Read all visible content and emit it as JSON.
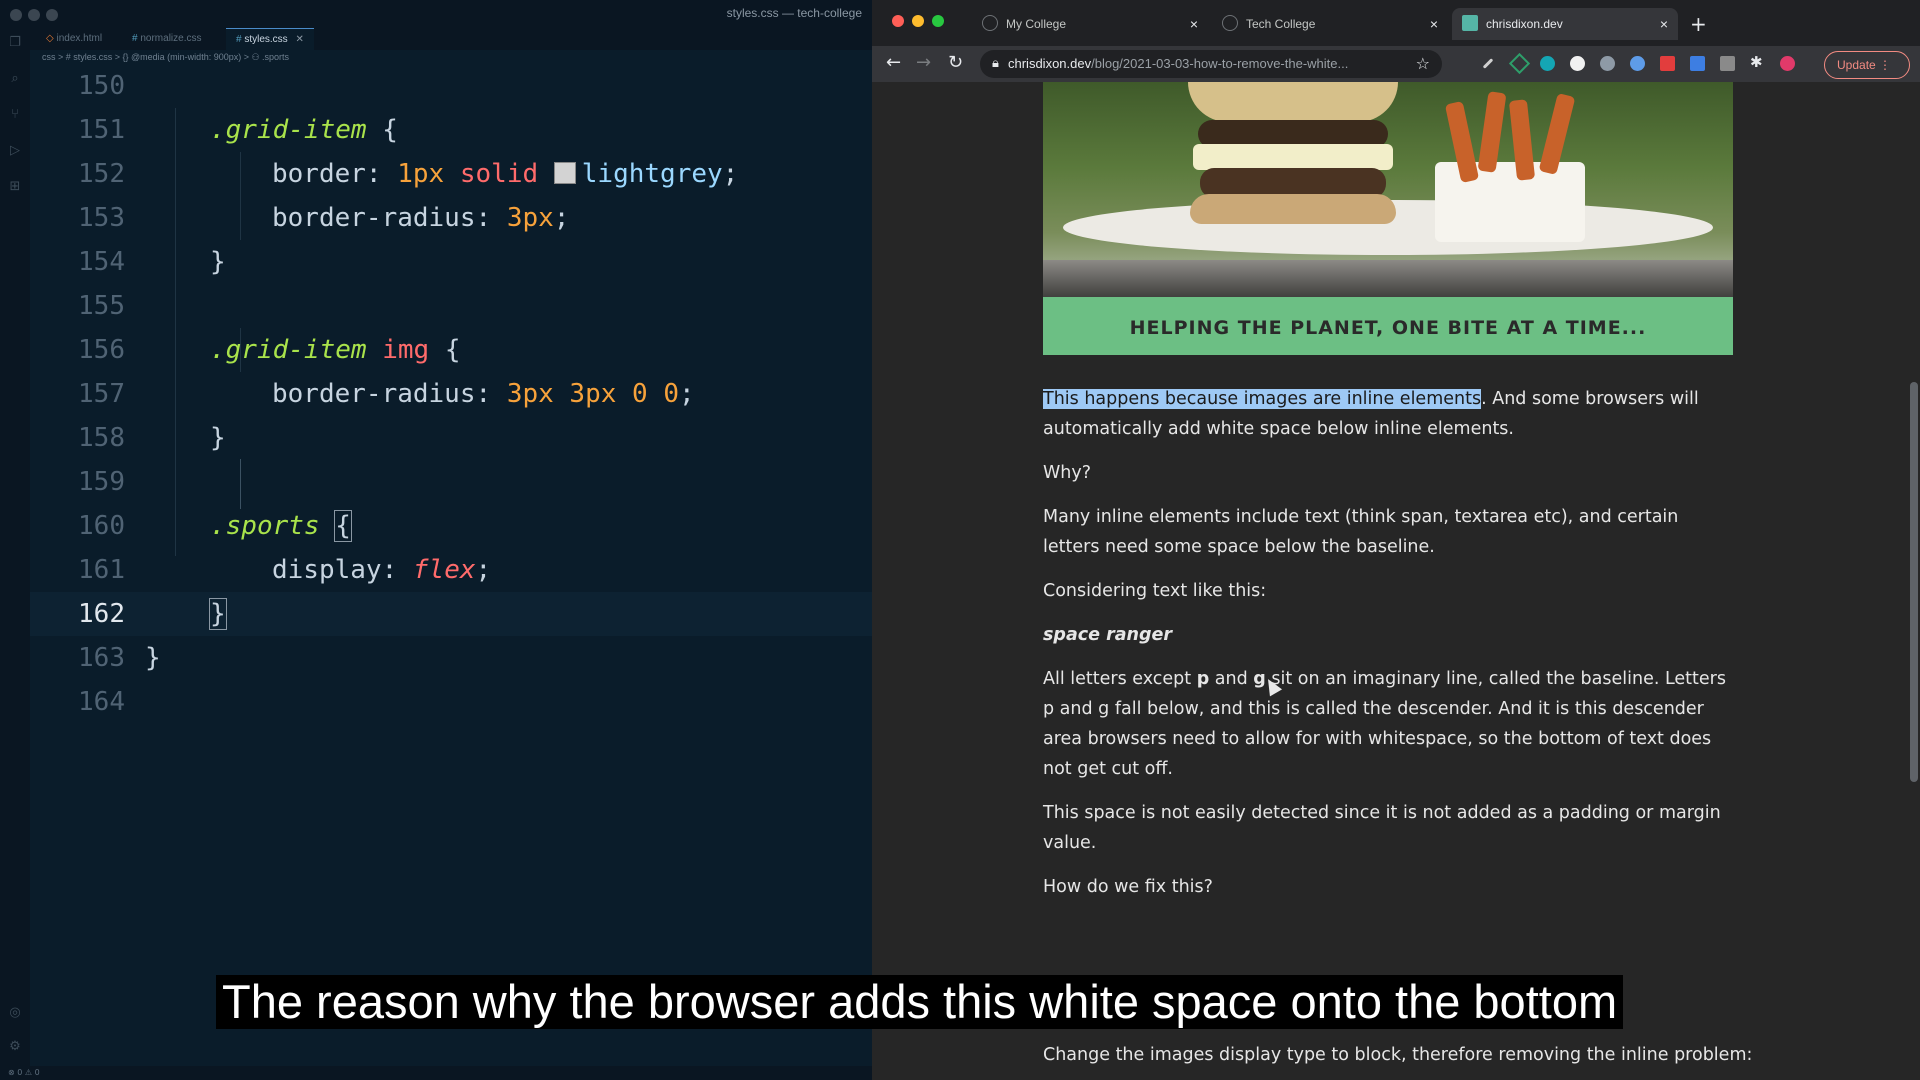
{
  "editor": {
    "window_title": "styles.css — tech-college",
    "tabs": [
      {
        "label": "index.html",
        "icon": "html-file-icon"
      },
      {
        "label": "normalize.css",
        "icon": "css-file-icon"
      },
      {
        "label": "styles.css",
        "icon": "css-file-icon",
        "active": true
      }
    ],
    "breadcrumb": "css > # styles.css > {} @media (min-width: 900px) > ⚇ .sports",
    "line_numbers": [
      "150",
      "151",
      "152",
      "153",
      "154",
      "155",
      "156",
      "157",
      "158",
      "159",
      "160",
      "161",
      "162",
      "163",
      "164"
    ],
    "current_line": "162",
    "code": {
      "l151_sel": ".grid-item",
      "l151_brace": " {",
      "l152_prop": "border: ",
      "l152_num": "1px",
      "l152_kw": " solid ",
      "l152_val": "lightgrey",
      "l152_end": ";",
      "l153_prop": "border-radius: ",
      "l153_num": "3px",
      "l153_end": ";",
      "l154": "}",
      "l156_sel": ".grid-item",
      "l156_tag": " img",
      "l156_brace": " {",
      "l157_prop": "border-radius: ",
      "l157_num1": "3px",
      "l157_num2": " 3px",
      "l157_num3": " 0",
      "l157_num4": " 0",
      "l157_end": ";",
      "l158": "}",
      "l160_sel": ".sports",
      "l160_brace": "{",
      "l161_prop": "display: ",
      "l161_val": "flex",
      "l161_end": ";",
      "l162": "}",
      "l163": "}"
    },
    "swatch_color": "#d3d3d3",
    "status": "⊗ 0 ⚠ 0"
  },
  "browser": {
    "tabs": [
      {
        "label": "My College",
        "close": "×"
      },
      {
        "label": "Tech College",
        "close": "×"
      },
      {
        "label": "chrisdixon.dev",
        "close": "×",
        "active": true
      }
    ],
    "new_tab": "+",
    "url_domain": "chrisdixon.dev",
    "url_path": "/blog/2021-03-03-how-to-remove-the-white...",
    "update_label": "Update",
    "banner": "HELPING THE PLANET, ONE BITE AT A TIME...",
    "article": {
      "p1_highlight": "This happens because images are inline elements",
      "p1_rest": ". And some browsers will automatically add white space below inline elements.",
      "p2": "Why?",
      "p3": "Many inline elements include text (think span, textarea etc), and certain letters need some space below the baseline.",
      "p4": "Considering text like this:",
      "p5": "space ranger",
      "p6_a": "All letters except ",
      "p6_p": "p",
      "p6_b": " and ",
      "p6_g": "g",
      "p6_c": " sit on an imaginary line, called the baseline. Letters p and g fall below, and this is called the descender. And it is this descender area browsers need to allow for with whitespace, so the bottom of text does not get cut off.",
      "p7": "This space is not easily detected since it is not added as a padding or margin value.",
      "p8": "How do we fix this?",
      "p9": "Change the images display type to block, therefore removing the inline problem:"
    }
  },
  "caption": "The reason why the browser adds this white space onto the bottom"
}
